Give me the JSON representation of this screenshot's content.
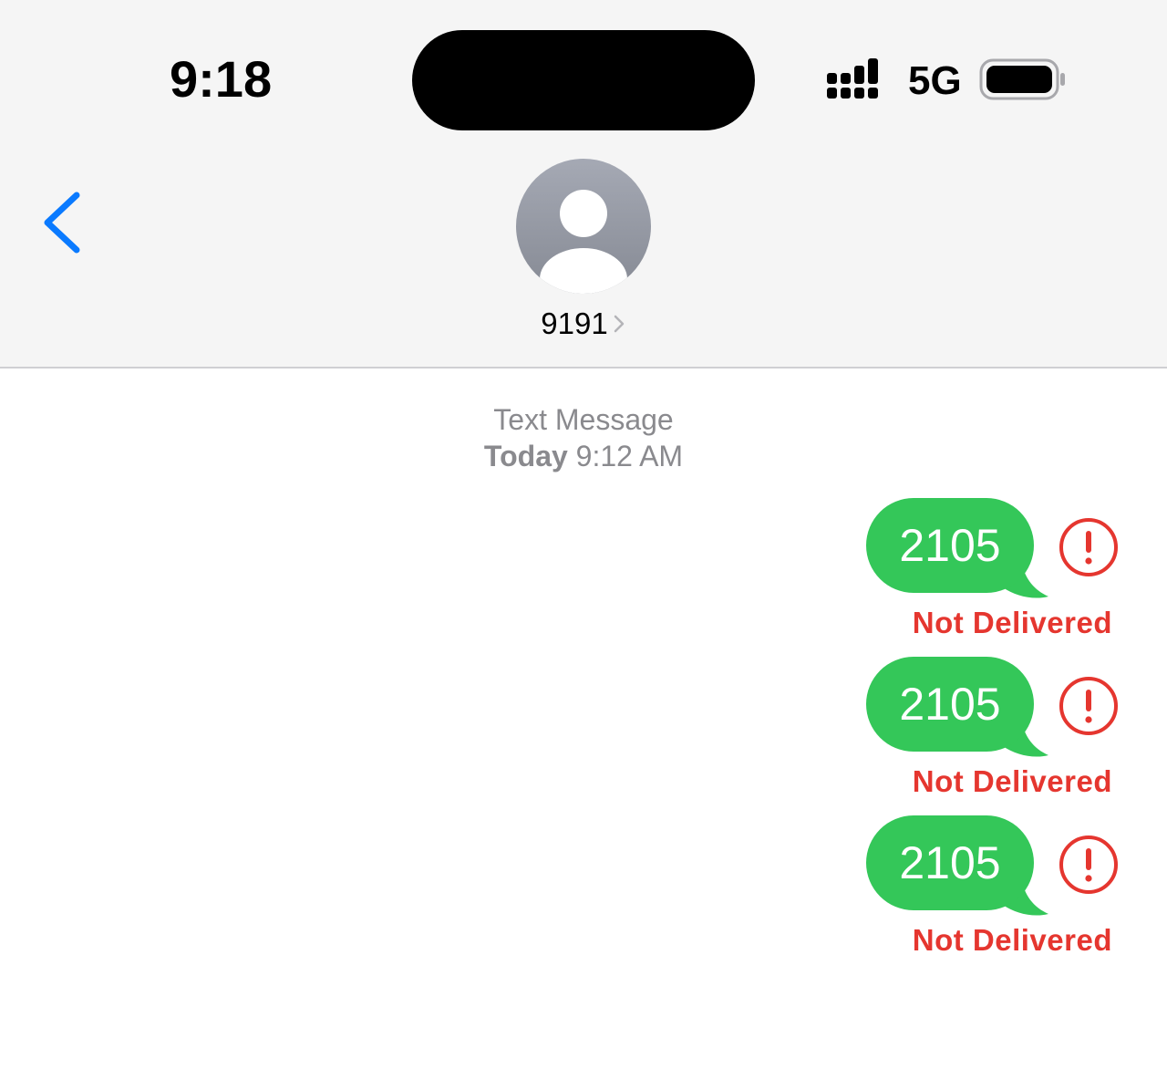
{
  "status_bar": {
    "time": "9:18",
    "network": "5G",
    "icons": [
      "signal-icon",
      "battery-icon"
    ]
  },
  "nav": {
    "back_icon": "chevron-left-icon",
    "contact": {
      "name": "9191",
      "avatar_icon": "person-avatar-icon",
      "chevron_icon": "chevron-right-icon"
    }
  },
  "thread": {
    "service_label": "Text Message",
    "day_label": "Today",
    "time_label": "9:12 AM",
    "messages": [
      {
        "text": "2105",
        "status": "Not Delivered",
        "error_icon": "exclamation-circle-icon"
      },
      {
        "text": "2105",
        "status": "Not Delivered",
        "error_icon": "exclamation-circle-icon"
      },
      {
        "text": "2105",
        "status": "Not Delivered",
        "error_icon": "exclamation-circle-icon"
      }
    ]
  },
  "colors": {
    "bubble": "#34c759",
    "error": "#e5362f",
    "accent": "#0a7aff",
    "meta_text": "#8a8a8e",
    "header_bg": "#f5f5f5"
  }
}
